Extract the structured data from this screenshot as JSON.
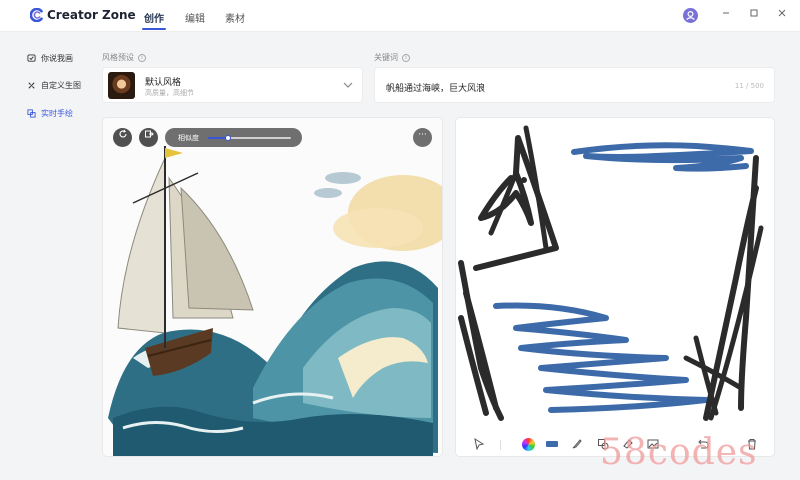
{
  "app": {
    "title": "Creator Zone"
  },
  "tabs": [
    {
      "label": "创作",
      "active": true
    },
    {
      "label": "编辑",
      "active": false
    },
    {
      "label": "素材",
      "active": false
    }
  ],
  "window_controls": [
    "minimize",
    "maximize",
    "close"
  ],
  "sidebar": {
    "items": [
      {
        "label": "你说我画",
        "icon": "chat-draw-icon",
        "active": false
      },
      {
        "label": "自定义生图",
        "icon": "custom-image-icon",
        "active": false
      },
      {
        "label": "实时手绘",
        "icon": "realtime-sketch-icon",
        "active": true
      }
    ]
  },
  "style_preset": {
    "label": "风格预设",
    "selected_name": "默认风格",
    "selected_desc": "高质量，高细节"
  },
  "keyword": {
    "label": "关键词",
    "value": "帆船通过海峡，巨大风浪",
    "counter": "11 / 500"
  },
  "result": {
    "similarity_label": "相似度",
    "similarity_value": 0.25
  },
  "canvas": {
    "brush_color": "#3d6aa8",
    "tools": [
      "select-icon",
      "color-picker-icon",
      "brush-color-swatch",
      "brush-icon",
      "shape-icon",
      "eraser-icon",
      "image-icon",
      "undo-icon",
      "delete-icon"
    ]
  },
  "colors": {
    "accent": "#3a57d8",
    "brand_purple": "#7a71d8"
  },
  "watermark": "58codes"
}
